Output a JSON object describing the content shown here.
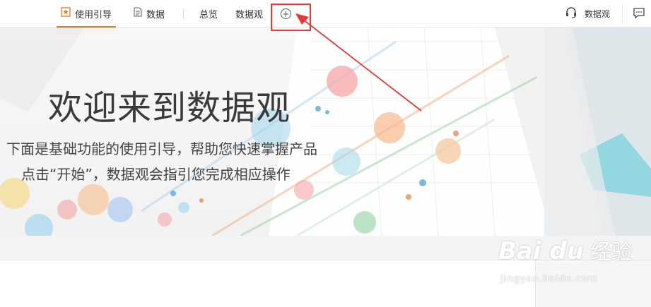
{
  "nav": {
    "tabs": [
      {
        "label": "使用引导",
        "icon": "star-badge-icon",
        "active": true
      },
      {
        "label": "数据",
        "icon": "document-icon"
      },
      {
        "label": "总览"
      },
      {
        "label": "数据观"
      }
    ],
    "add_icon": "plus-circle-icon",
    "help_label": "数据观",
    "help_icon": "headset-icon",
    "message_icon": "chat-icon"
  },
  "banner": {
    "title": "欢迎来到数据观",
    "line1": "下面是基础功能的使用引导，帮助您快速掌握产品",
    "line2": "点击“开始”，数据观会指引您完成相应操作"
  },
  "watermark": {
    "logo": "Bai du",
    "cn": "经验",
    "url": "jingyan.baidu.com"
  },
  "colors": {
    "accent": "#e8762b",
    "annotation": "#e53935"
  }
}
